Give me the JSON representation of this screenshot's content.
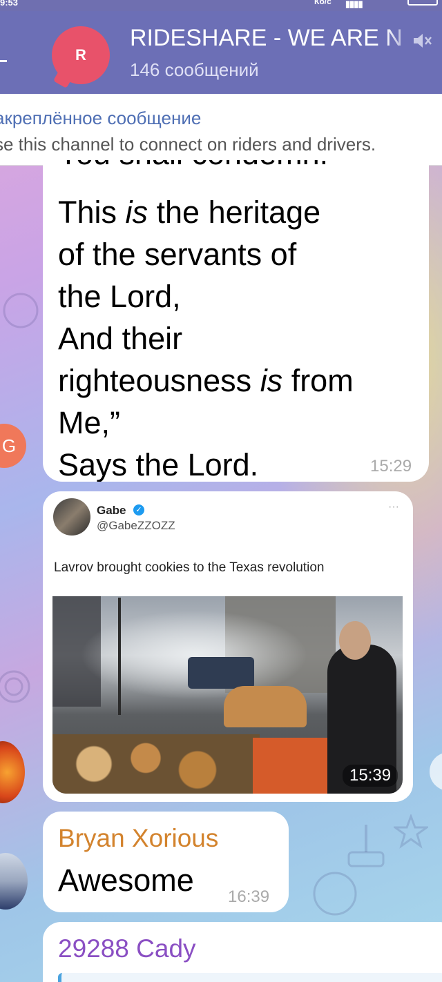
{
  "status_bar": {
    "time": "9:53",
    "network": "Кб/с"
  },
  "header": {
    "avatar_letter": "R",
    "title": "RIDESHARE - WE ARE N",
    "subtitle": "146 сообщений",
    "accent": "#6c6fb6"
  },
  "pinned": {
    "label": "акреплённое сообщение",
    "text": "se this channel to connect on riders and drivers."
  },
  "messages": [
    {
      "avatar_letter": "G",
      "verse_cut": "You shall condemn.",
      "lines": [
        {
          "pre": "This ",
          "em": "is",
          "post": " the heritage"
        },
        {
          "pre": "of the servants of",
          "em": "",
          "post": ""
        },
        {
          "pre": "the Lord,",
          "em": "",
          "post": ""
        },
        {
          "pre": "And their",
          "em": "",
          "post": ""
        },
        {
          "pre": "righteousness ",
          "em": "is",
          "post": " from"
        },
        {
          "pre": "Me,”",
          "em": "",
          "post": ""
        },
        {
          "pre": "Says the Lord.",
          "em": "",
          "post": ""
        }
      ],
      "time": "15:29"
    },
    {
      "tweet": {
        "name": "Gabe",
        "handle": "@GabeZZOZZ",
        "dots": "···",
        "text": "Lavrov brought cookies to the Texas revolution"
      },
      "time": "15:39"
    },
    {
      "sender": "Bryan Xorious",
      "text": "Awesome",
      "time": "16:39"
    },
    {
      "sender": "29288 Cady"
    }
  ]
}
